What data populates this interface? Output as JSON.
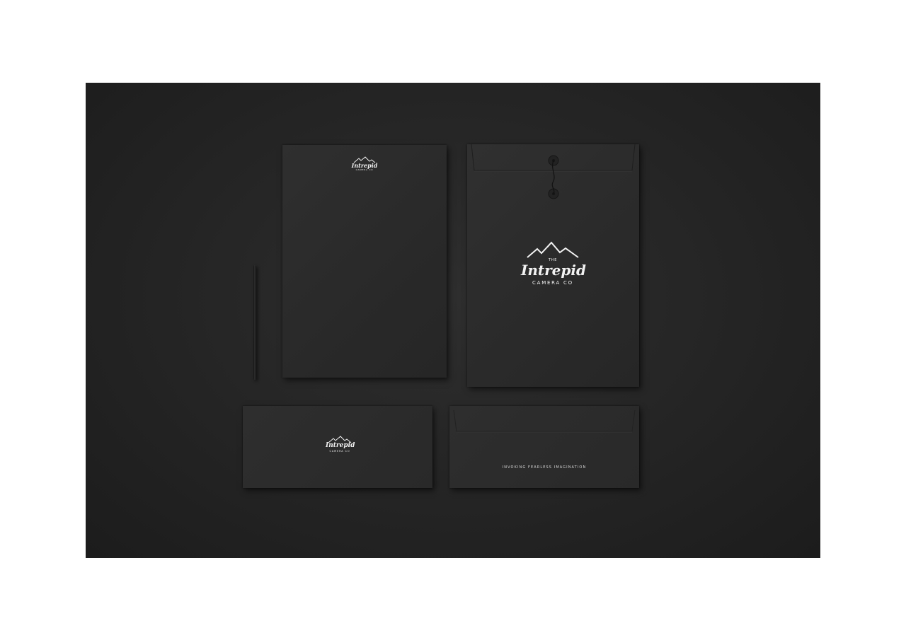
{
  "brand": {
    "the": "THE",
    "name": "Intrepid",
    "sub": "CAMERA CO"
  },
  "envelope_back": {
    "tagline": "INVOKING FEARLESS IMAGINATION"
  },
  "colors": {
    "background": "#ffffff",
    "stage": "#262626",
    "paper": "#2b2b2b",
    "logo": "#f2f2f2"
  },
  "icons": [
    "mountain-logo-icon",
    "string-button-icon"
  ]
}
